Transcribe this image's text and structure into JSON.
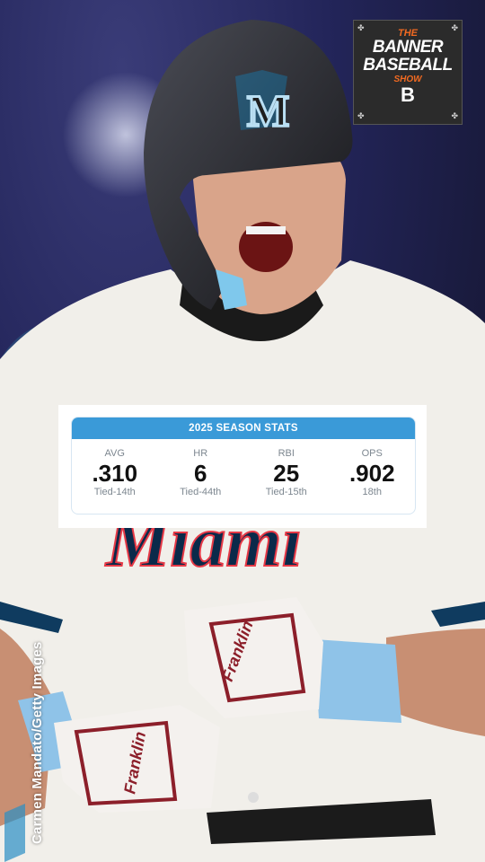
{
  "brand": {
    "logo_the": "THE",
    "logo_line1": "BANNER",
    "logo_line2": "BASEBALL",
    "logo_show": "SHOW",
    "logo_mark": "B",
    "accent": "#f26a21"
  },
  "stats_card": {
    "title": "2025 SEASON STATS",
    "header_color": "#3a9ad8",
    "stats": [
      {
        "label": "AVG",
        "value": ".310",
        "rank": "Tied-14th"
      },
      {
        "label": "HR",
        "value": "6",
        "rank": "Tied-44th"
      },
      {
        "label": "RBI",
        "value": "25",
        "rank": "Tied-15th"
      },
      {
        "label": "OPS",
        "value": ".902",
        "rank": "18th"
      }
    ]
  },
  "jersey": {
    "wordmark": "Miami",
    "helmet_logo": "M"
  },
  "gloves": {
    "brand": "Franklin"
  },
  "credit": "Carmen Mandato/Getty Images"
}
